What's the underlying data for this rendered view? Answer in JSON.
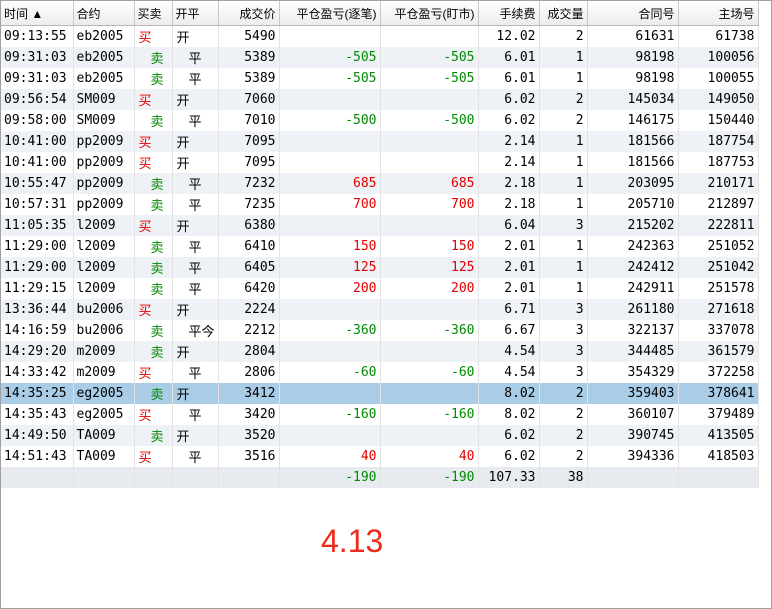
{
  "columns": [
    {
      "key": "time",
      "label": "时间 ▲"
    },
    {
      "key": "contract",
      "label": "合约"
    },
    {
      "key": "side",
      "label": "买卖"
    },
    {
      "key": "openclose",
      "label": "开平"
    },
    {
      "key": "price",
      "label": "成交价"
    },
    {
      "key": "pnl_trade",
      "label": "平仓盈亏(逐笔)"
    },
    {
      "key": "pnl_mtm",
      "label": "平仓盈亏(盯市)"
    },
    {
      "key": "fee",
      "label": "手续费"
    },
    {
      "key": "volume",
      "label": "成交量"
    },
    {
      "key": "order_id",
      "label": "合同号"
    },
    {
      "key": "exch_id",
      "label": "主场号"
    }
  ],
  "rows": [
    {
      "time": "09:13:55",
      "contract": "eb2005",
      "side": "买",
      "openclose": "开",
      "price": "5490",
      "pnl_trade": "",
      "pnl_mtm": "",
      "fee": "12.02",
      "volume": "2",
      "order_id": "61631",
      "exch_id": "61738"
    },
    {
      "time": "09:31:03",
      "contract": "eb2005",
      "side": "卖",
      "openclose": "平",
      "price": "5389",
      "pnl_trade": "-505",
      "pnl_mtm": "-505",
      "fee": "6.01",
      "volume": "1",
      "order_id": "98198",
      "exch_id": "100056"
    },
    {
      "time": "09:31:03",
      "contract": "eb2005",
      "side": "卖",
      "openclose": "平",
      "price": "5389",
      "pnl_trade": "-505",
      "pnl_mtm": "-505",
      "fee": "6.01",
      "volume": "1",
      "order_id": "98198",
      "exch_id": "100055"
    },
    {
      "time": "09:56:54",
      "contract": "SM009",
      "side": "买",
      "openclose": "开",
      "price": "7060",
      "pnl_trade": "",
      "pnl_mtm": "",
      "fee": "6.02",
      "volume": "2",
      "order_id": "145034",
      "exch_id": "149050"
    },
    {
      "time": "09:58:00",
      "contract": "SM009",
      "side": "卖",
      "openclose": "平",
      "price": "7010",
      "pnl_trade": "-500",
      "pnl_mtm": "-500",
      "fee": "6.02",
      "volume": "2",
      "order_id": "146175",
      "exch_id": "150440"
    },
    {
      "time": "10:41:00",
      "contract": "pp2009",
      "side": "买",
      "openclose": "开",
      "price": "7095",
      "pnl_trade": "",
      "pnl_mtm": "",
      "fee": "2.14",
      "volume": "1",
      "order_id": "181566",
      "exch_id": "187754"
    },
    {
      "time": "10:41:00",
      "contract": "pp2009",
      "side": "买",
      "openclose": "开",
      "price": "7095",
      "pnl_trade": "",
      "pnl_mtm": "",
      "fee": "2.14",
      "volume": "1",
      "order_id": "181566",
      "exch_id": "187753"
    },
    {
      "time": "10:55:47",
      "contract": "pp2009",
      "side": "卖",
      "openclose": "平",
      "price": "7232",
      "pnl_trade": "685",
      "pnl_mtm": "685",
      "fee": "2.18",
      "volume": "1",
      "order_id": "203095",
      "exch_id": "210171"
    },
    {
      "time": "10:57:31",
      "contract": "pp2009",
      "side": "卖",
      "openclose": "平",
      "price": "7235",
      "pnl_trade": "700",
      "pnl_mtm": "700",
      "fee": "2.18",
      "volume": "1",
      "order_id": "205710",
      "exch_id": "212897"
    },
    {
      "time": "11:05:35",
      "contract": "l2009",
      "side": "买",
      "openclose": "开",
      "price": "6380",
      "pnl_trade": "",
      "pnl_mtm": "",
      "fee": "6.04",
      "volume": "3",
      "order_id": "215202",
      "exch_id": "222811"
    },
    {
      "time": "11:29:00",
      "contract": "l2009",
      "side": "卖",
      "openclose": "平",
      "price": "6410",
      "pnl_trade": "150",
      "pnl_mtm": "150",
      "fee": "2.01",
      "volume": "1",
      "order_id": "242363",
      "exch_id": "251052"
    },
    {
      "time": "11:29:00",
      "contract": "l2009",
      "side": "卖",
      "openclose": "平",
      "price": "6405",
      "pnl_trade": "125",
      "pnl_mtm": "125",
      "fee": "2.01",
      "volume": "1",
      "order_id": "242412",
      "exch_id": "251042"
    },
    {
      "time": "11:29:15",
      "contract": "l2009",
      "side": "卖",
      "openclose": "平",
      "price": "6420",
      "pnl_trade": "200",
      "pnl_mtm": "200",
      "fee": "2.01",
      "volume": "1",
      "order_id": "242911",
      "exch_id": "251578"
    },
    {
      "time": "13:36:44",
      "contract": "bu2006",
      "side": "买",
      "openclose": "开",
      "price": "2224",
      "pnl_trade": "",
      "pnl_mtm": "",
      "fee": "6.71",
      "volume": "3",
      "order_id": "261180",
      "exch_id": "271618"
    },
    {
      "time": "14:16:59",
      "contract": "bu2006",
      "side": "卖",
      "openclose": "平今",
      "price": "2212",
      "pnl_trade": "-360",
      "pnl_mtm": "-360",
      "fee": "6.67",
      "volume": "3",
      "order_id": "322137",
      "exch_id": "337078"
    },
    {
      "time": "14:29:20",
      "contract": "m2009",
      "side": "卖",
      "openclose": "开",
      "price": "2804",
      "pnl_trade": "",
      "pnl_mtm": "",
      "fee": "4.54",
      "volume": "3",
      "order_id": "344485",
      "exch_id": "361579"
    },
    {
      "time": "14:33:42",
      "contract": "m2009",
      "side": "买",
      "openclose": "平",
      "price": "2806",
      "pnl_trade": "-60",
      "pnl_mtm": "-60",
      "fee": "4.54",
      "volume": "3",
      "order_id": "354329",
      "exch_id": "372258"
    },
    {
      "time": "14:35:25",
      "contract": "eg2005",
      "side": "卖",
      "openclose": "开",
      "price": "3412",
      "pnl_trade": "",
      "pnl_mtm": "",
      "fee": "8.02",
      "volume": "2",
      "order_id": "359403",
      "exch_id": "378641",
      "selected": true
    },
    {
      "time": "14:35:43",
      "contract": "eg2005",
      "side": "买",
      "openclose": "平",
      "price": "3420",
      "pnl_trade": "-160",
      "pnl_mtm": "-160",
      "fee": "8.02",
      "volume": "2",
      "order_id": "360107",
      "exch_id": "379489"
    },
    {
      "time": "14:49:50",
      "contract": "TA009",
      "side": "卖",
      "openclose": "开",
      "price": "3520",
      "pnl_trade": "",
      "pnl_mtm": "",
      "fee": "6.02",
      "volume": "2",
      "order_id": "390745",
      "exch_id": "413505"
    },
    {
      "time": "14:51:43",
      "contract": "TA009",
      "side": "买",
      "openclose": "平",
      "price": "3516",
      "pnl_trade": "40",
      "pnl_mtm": "40",
      "fee": "6.02",
      "volume": "2",
      "order_id": "394336",
      "exch_id": "418503"
    }
  ],
  "totals": {
    "time": "",
    "contract": "",
    "side": "",
    "openclose": "",
    "price": "",
    "pnl_trade": "-190",
    "pnl_mtm": "-190",
    "fee": "107.33",
    "volume": "38",
    "order_id": "",
    "exch_id": ""
  },
  "note": "4.13",
  "colors": {
    "buy": "#e00000",
    "sell": "#008a00",
    "selected_row": "#a9cde6",
    "note": "#ee2a1a"
  }
}
